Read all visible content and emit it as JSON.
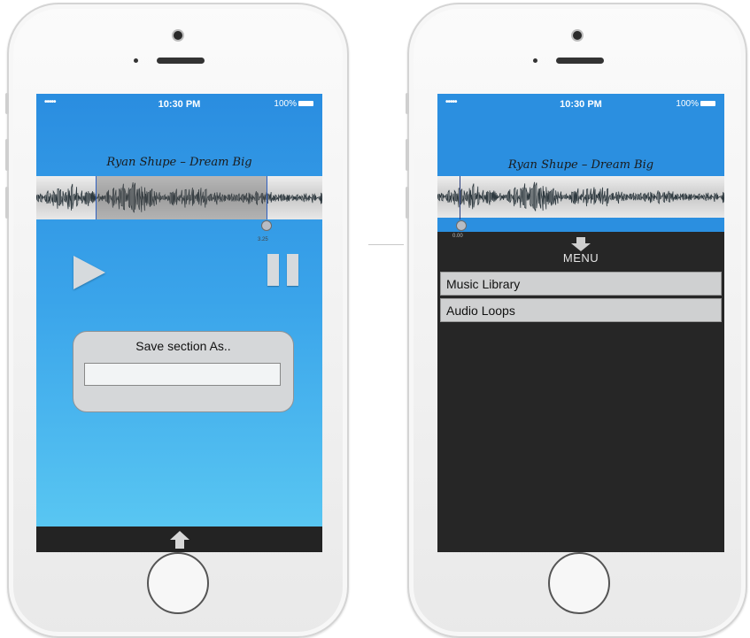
{
  "left_screen": {
    "status": {
      "signal": "•••••",
      "time": "10:30 PM",
      "battery": "100%"
    },
    "song_title": "Ryan Shupe – Dream Big",
    "marker_time": "3.25",
    "dialog": {
      "title": "Save section As..",
      "input_value": ""
    },
    "icons": {
      "play": "play-icon",
      "pause": "pause-icon",
      "menu_toggle": "arrow-up-icon"
    },
    "colors": {
      "background_top": "#2b8fe0",
      "background_bottom": "#5cc8f2",
      "bar": "#232323"
    }
  },
  "right_screen": {
    "status": {
      "signal": "•••••",
      "time": "10:30 PM",
      "battery": "100%"
    },
    "song_title": "Ryan Shupe – Dream Big",
    "marker_time": "0.00",
    "menu": {
      "label": "MENU",
      "items": [
        {
          "label": "Music Library"
        },
        {
          "label": "Audio Loops"
        }
      ]
    },
    "colors": {
      "header": "#2b8fe0",
      "menu_background": "#262626"
    }
  }
}
